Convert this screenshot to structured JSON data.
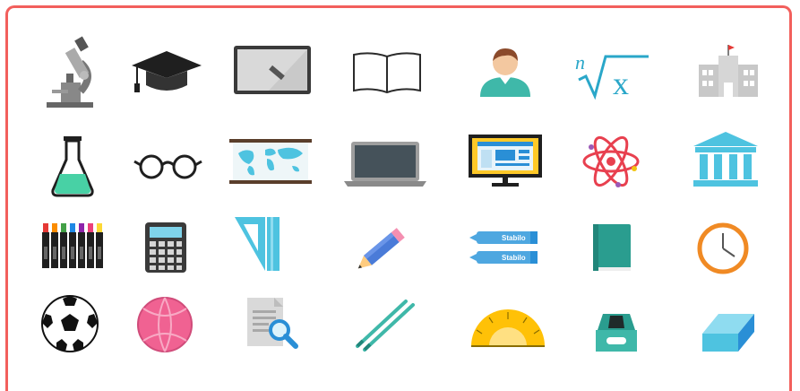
{
  "icons": {
    "root_symbol": {
      "index": "n",
      "radicand": "x"
    },
    "highlighter": {
      "brand_top": "Stabilo",
      "brand_bottom": "Stabilo"
    }
  },
  "colors": {
    "frame": "#f25f5c",
    "teal": "#3fb8a9",
    "sky": "#4ec3e0",
    "dark": "#2b2b2b",
    "orange": "#f08a24",
    "pink": "#f06292"
  }
}
